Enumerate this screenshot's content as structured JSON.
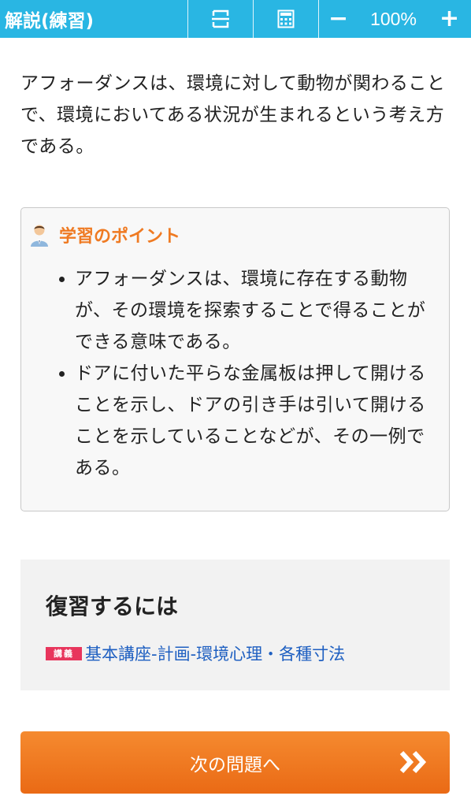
{
  "header": {
    "title": "解説(練習)",
    "zoom_out_label": "−",
    "zoom_level": "100%",
    "zoom_in_label": "+"
  },
  "explanation": "アフォーダンスは、環境に対して動物が関わることで、環境においてある状況が生まれるという考え方である。",
  "point": {
    "title": "学習のポイント",
    "items": [
      "アフォーダンスは、環境に存在する動物が、その環境を探索することで得ることができる意味である。",
      "ドアに付いた平らな金属板は押して開けることを示し、ドアの引き手は引いて開けることを示していることなどが、その一例である。"
    ]
  },
  "review": {
    "heading": "復習するには",
    "badge": "講義",
    "link": "基本講座-計画-環境心理・各種寸法"
  },
  "next_button": {
    "label": "次の問題へ"
  },
  "colors": {
    "header_bg": "#29b6e3",
    "point_title": "#ef7a22",
    "badge_bg": "#e8355c",
    "link": "#1e5fc1",
    "button_bg": "#f07a24"
  }
}
